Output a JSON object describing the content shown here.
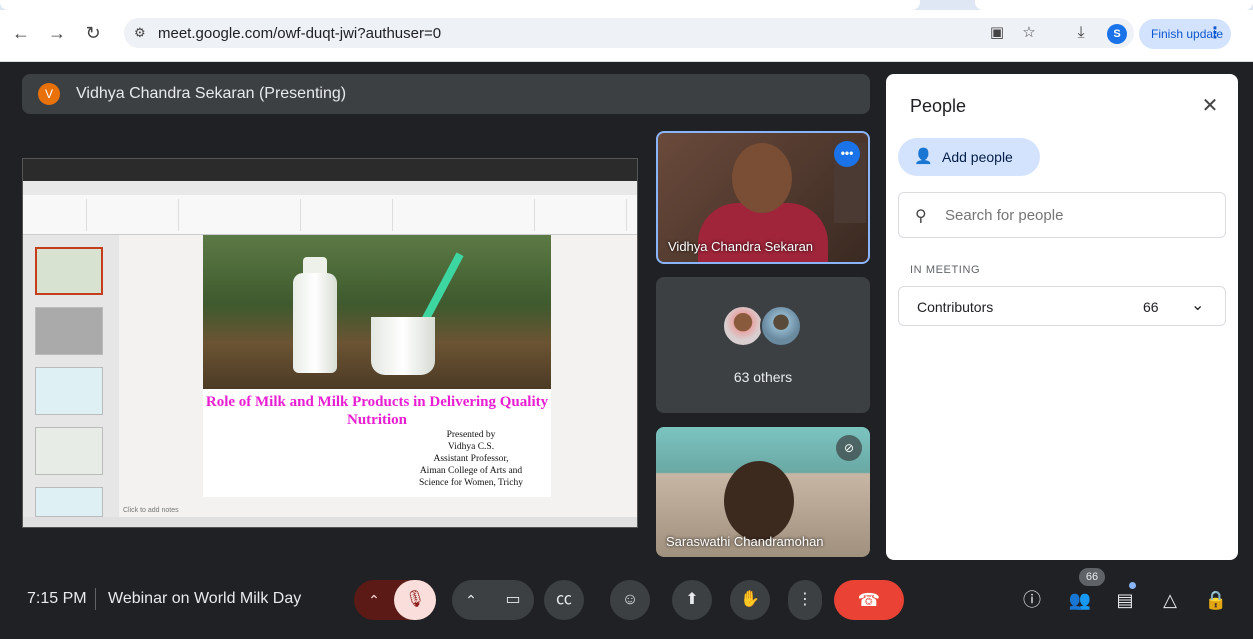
{
  "browser": {
    "url": "meet.google.com/owf-duqt-jwi?authuser=0",
    "profile_initial": "S",
    "finish_update_label": "Finish update"
  },
  "presenter": {
    "initial": "V",
    "banner_text": "Vidhya Chandra Sekaran (Presenting)"
  },
  "slide": {
    "title": "Role of Milk and Milk Products in Delivering Quality Nutrition",
    "presented_lines": [
      "Presented by",
      "Vidhya C.S.",
      "Assistant Professor,",
      "Aiman College of Arts and",
      "Science for Women, Trichy"
    ],
    "notes_placeholder": "Click to add notes"
  },
  "tiles": {
    "tile1_name": "Vidhya Chandra Sekaran",
    "others_label": "63 others",
    "tile3_name": "Saraswathi Chandramohan"
  },
  "people_panel": {
    "heading": "People",
    "add_people_label": "Add people",
    "search_placeholder": "Search for people",
    "section_label": "IN MEETING",
    "contributors_label": "Contributors",
    "contributors_count": "66"
  },
  "bottom_bar": {
    "time": "7:15 PM",
    "meeting_name": "Webinar on World Milk Day",
    "participants_badge": "66"
  },
  "colors": {
    "end_call": "#ea4335",
    "accent_blue": "#1a73e8",
    "slide_title": "#e91ed3"
  }
}
